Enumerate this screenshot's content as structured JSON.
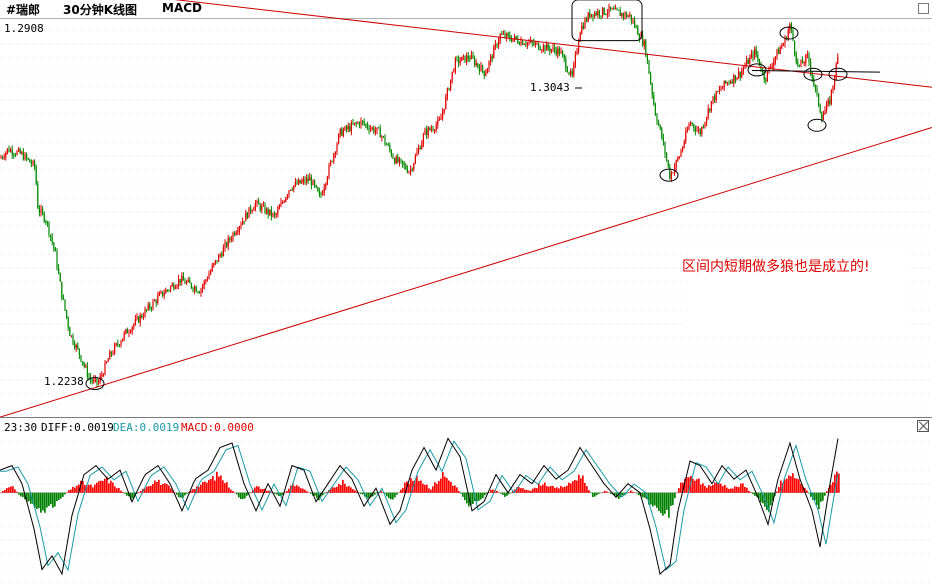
{
  "header": {
    "symbol": "#瑞郎",
    "period": "30分钟K线图",
    "indicator": "MACD"
  },
  "chart_data": [
    {
      "type": "candlestick",
      "title": "#瑞郎 30分钟K线图",
      "y_top_label": "1.2908",
      "ylim": [
        1.218,
        1.2908
      ],
      "grid": true,
      "price_path": [
        {
          "x": 0,
          "y": 1.2653
        },
        {
          "x": 8,
          "y": 1.267
        },
        {
          "x": 22,
          "y": 1.266
        },
        {
          "x": 35,
          "y": 1.2637
        },
        {
          "x": 38,
          "y": 1.256
        },
        {
          "x": 46,
          "y": 1.254
        },
        {
          "x": 55,
          "y": 1.248
        },
        {
          "x": 62,
          "y": 1.24
        },
        {
          "x": 70,
          "y": 1.233
        },
        {
          "x": 80,
          "y": 1.229
        },
        {
          "x": 90,
          "y": 1.2245
        },
        {
          "x": 98,
          "y": 1.2238
        },
        {
          "x": 110,
          "y": 1.229
        },
        {
          "x": 125,
          "y": 1.233
        },
        {
          "x": 140,
          "y": 1.236
        },
        {
          "x": 160,
          "y": 1.24
        },
        {
          "x": 180,
          "y": 1.243
        },
        {
          "x": 200,
          "y": 1.241
        },
        {
          "x": 215,
          "y": 1.246
        },
        {
          "x": 235,
          "y": 1.252
        },
        {
          "x": 255,
          "y": 1.257
        },
        {
          "x": 275,
          "y": 1.2545
        },
        {
          "x": 290,
          "y": 1.26
        },
        {
          "x": 310,
          "y": 1.2615
        },
        {
          "x": 320,
          "y": 1.258
        },
        {
          "x": 340,
          "y": 1.27
        },
        {
          "x": 360,
          "y": 1.272
        },
        {
          "x": 380,
          "y": 1.27
        },
        {
          "x": 395,
          "y": 1.265
        },
        {
          "x": 410,
          "y": 1.263
        },
        {
          "x": 425,
          "y": 1.27
        },
        {
          "x": 440,
          "y": 1.272
        },
        {
          "x": 455,
          "y": 1.283
        },
        {
          "x": 470,
          "y": 1.284
        },
        {
          "x": 485,
          "y": 1.281
        },
        {
          "x": 500,
          "y": 1.288
        },
        {
          "x": 520,
          "y": 1.287
        },
        {
          "x": 540,
          "y": 1.286
        },
        {
          "x": 560,
          "y": 1.285
        },
        {
          "x": 572,
          "y": 1.28
        },
        {
          "x": 580,
          "y": 1.289
        },
        {
          "x": 590,
          "y": 1.292
        },
        {
          "x": 610,
          "y": 1.2925
        },
        {
          "x": 630,
          "y": 1.2915
        },
        {
          "x": 645,
          "y": 1.286
        },
        {
          "x": 655,
          "y": 1.274
        },
        {
          "x": 662,
          "y": 1.269
        },
        {
          "x": 670,
          "y": 1.262
        },
        {
          "x": 680,
          "y": 1.266
        },
        {
          "x": 690,
          "y": 1.272
        },
        {
          "x": 700,
          "y": 1.27
        },
        {
          "x": 712,
          "y": 1.276
        },
        {
          "x": 725,
          "y": 1.279
        },
        {
          "x": 740,
          "y": 1.281
        },
        {
          "x": 755,
          "y": 1.285
        },
        {
          "x": 765,
          "y": 1.28
        },
        {
          "x": 775,
          "y": 1.284
        },
        {
          "x": 785,
          "y": 1.287
        },
        {
          "x": 790,
          "y": 1.29
        },
        {
          "x": 798,
          "y": 1.282
        },
        {
          "x": 808,
          "y": 1.284
        },
        {
          "x": 815,
          "y": 1.278
        },
        {
          "x": 822,
          "y": 1.273
        },
        {
          "x": 830,
          "y": 1.276
        },
        {
          "x": 838,
          "y": 1.284
        }
      ],
      "annotations": [
        {
          "text": "1.3043",
          "type": "label"
        },
        {
          "text": "1.2238",
          "type": "label"
        },
        {
          "text": "区间内短期做多狼也是成立的!",
          "type": "note",
          "color": "#e00000"
        }
      ],
      "trendlines": [
        {
          "name": "upper-resistance",
          "color": "#cc0000",
          "from": [
            0,
            1.2983
          ],
          "to": [
            932,
            1.2784
          ]
        },
        {
          "name": "lower-support",
          "color": "#cc0000",
          "from": [
            0,
            1.2176
          ],
          "to": [
            932,
            1.271
          ]
        },
        {
          "name": "short-resistance",
          "color": "#000000",
          "from": [
            752,
            1.2815
          ],
          "to": [
            880,
            1.2812
          ]
        }
      ],
      "ellipses": [
        {
          "cx": 95,
          "cy": 1.2238
        },
        {
          "cx": 669,
          "cy": 1.2622
        },
        {
          "cx": 757,
          "cy": 1.2816
        },
        {
          "cx": 789,
          "cy": 1.2884
        },
        {
          "cx": 813,
          "cy": 1.2808
        },
        {
          "cx": 838,
          "cy": 1.2808
        },
        {
          "cx": 817,
          "cy": 1.2714
        }
      ],
      "highlight_box": {
        "from_x": 572,
        "to_x": 642
      }
    },
    {
      "type": "bar+line",
      "title": "MACD",
      "time": "23:30",
      "legend": [
        {
          "name": "DIFF",
          "value": "0.0019",
          "color": "#000000"
        },
        {
          "name": "DEA",
          "value": "0.0019",
          "color": "#1a9aa6"
        },
        {
          "name": "MACD",
          "value": "0.0000",
          "color": "#e00000"
        }
      ],
      "bar_colors": {
        "positive": "#ff0000",
        "negative": "#008000"
      },
      "histogram_knots": [
        {
          "x": 0,
          "y": 0.0
        },
        {
          "x": 10,
          "y": 0.4
        },
        {
          "x": 20,
          "y": -0.2
        },
        {
          "x": 32,
          "y": -0.6
        },
        {
          "x": 45,
          "y": -1.0
        },
        {
          "x": 55,
          "y": -0.5
        },
        {
          "x": 68,
          "y": 0.1
        },
        {
          "x": 80,
          "y": 0.5
        },
        {
          "x": 92,
          "y": 0.3
        },
        {
          "x": 105,
          "y": 0.7
        },
        {
          "x": 118,
          "y": 0.2
        },
        {
          "x": 130,
          "y": -0.3
        },
        {
          "x": 142,
          "y": 0.2
        },
        {
          "x": 155,
          "y": 0.6
        },
        {
          "x": 168,
          "y": 0.3
        },
        {
          "x": 180,
          "y": -0.3
        },
        {
          "x": 192,
          "y": 0.2
        },
        {
          "x": 205,
          "y": 0.5
        },
        {
          "x": 218,
          "y": 0.9
        },
        {
          "x": 230,
          "y": 0.2
        },
        {
          "x": 242,
          "y": -0.4
        },
        {
          "x": 255,
          "y": 0.3
        },
        {
          "x": 268,
          "y": 0.1
        },
        {
          "x": 280,
          "y": -0.2
        },
        {
          "x": 292,
          "y": 0.4
        },
        {
          "x": 305,
          "y": 0.1
        },
        {
          "x": 318,
          "y": -0.3
        },
        {
          "x": 330,
          "y": 0.2
        },
        {
          "x": 342,
          "y": 0.5
        },
        {
          "x": 355,
          "y": 0.1
        },
        {
          "x": 368,
          "y": -0.3
        },
        {
          "x": 380,
          "y": 0.1
        },
        {
          "x": 392,
          "y": -0.4
        },
        {
          "x": 405,
          "y": 0.5
        },
        {
          "x": 418,
          "y": 0.7
        },
        {
          "x": 430,
          "y": 0.2
        },
        {
          "x": 442,
          "y": 0.9
        },
        {
          "x": 455,
          "y": 0.3
        },
        {
          "x": 468,
          "y": -0.6
        },
        {
          "x": 480,
          "y": -0.3
        },
        {
          "x": 492,
          "y": 0.2
        },
        {
          "x": 505,
          "y": -0.2
        },
        {
          "x": 518,
          "y": 0.3
        },
        {
          "x": 530,
          "y": 0.1
        },
        {
          "x": 542,
          "y": 0.5
        },
        {
          "x": 555,
          "y": 0.2
        },
        {
          "x": 568,
          "y": 0.4
        },
        {
          "x": 580,
          "y": 0.9
        },
        {
          "x": 592,
          "y": -0.2
        },
        {
          "x": 605,
          "y": 0.1
        },
        {
          "x": 618,
          "y": -0.3
        },
        {
          "x": 630,
          "y": 0.1
        },
        {
          "x": 642,
          "y": -0.2
        },
        {
          "x": 655,
          "y": -0.8
        },
        {
          "x": 668,
          "y": -1.0
        },
        {
          "x": 680,
          "y": 0.5
        },
        {
          "x": 692,
          "y": 0.8
        },
        {
          "x": 705,
          "y": 0.3
        },
        {
          "x": 718,
          "y": 0.5
        },
        {
          "x": 730,
          "y": 0.2
        },
        {
          "x": 742,
          "y": 0.4
        },
        {
          "x": 755,
          "y": -0.2
        },
        {
          "x": 768,
          "y": -0.8
        },
        {
          "x": 780,
          "y": 0.5
        },
        {
          "x": 792,
          "y": 0.9
        },
        {
          "x": 805,
          "y": 0.2
        },
        {
          "x": 818,
          "y": -0.8
        },
        {
          "x": 828,
          "y": 0.3
        },
        {
          "x": 838,
          "y": 1.0
        }
      ],
      "diff_knots": [
        {
          "x": 0,
          "y": 0.5
        },
        {
          "x": 12,
          "y": 0.6
        },
        {
          "x": 22,
          "y": 0.2
        },
        {
          "x": 34,
          "y": -0.8
        },
        {
          "x": 42,
          "y": -1.7
        },
        {
          "x": 52,
          "y": -1.4
        },
        {
          "x": 62,
          "y": -1.8
        },
        {
          "x": 72,
          "y": -0.5
        },
        {
          "x": 84,
          "y": 0.4
        },
        {
          "x": 96,
          "y": 0.6
        },
        {
          "x": 108,
          "y": 0.3
        },
        {
          "x": 120,
          "y": 0.5
        },
        {
          "x": 132,
          "y": -0.2
        },
        {
          "x": 145,
          "y": 0.4
        },
        {
          "x": 158,
          "y": 0.6
        },
        {
          "x": 170,
          "y": 0.2
        },
        {
          "x": 182,
          "y": -0.4
        },
        {
          "x": 195,
          "y": 0.3
        },
        {
          "x": 208,
          "y": 0.5
        },
        {
          "x": 220,
          "y": 1.0
        },
        {
          "x": 232,
          "y": 1.1
        },
        {
          "x": 244,
          "y": 0.2
        },
        {
          "x": 256,
          "y": -0.4
        },
        {
          "x": 268,
          "y": 0.2
        },
        {
          "x": 280,
          "y": -0.3
        },
        {
          "x": 292,
          "y": 0.6
        },
        {
          "x": 304,
          "y": 0.5
        },
        {
          "x": 316,
          "y": -0.2
        },
        {
          "x": 328,
          "y": 0.2
        },
        {
          "x": 340,
          "y": 0.6
        },
        {
          "x": 352,
          "y": 0.3
        },
        {
          "x": 364,
          "y": -0.3
        },
        {
          "x": 376,
          "y": 0.1
        },
        {
          "x": 390,
          "y": -0.7
        },
        {
          "x": 400,
          "y": -0.4
        },
        {
          "x": 412,
          "y": 0.5
        },
        {
          "x": 424,
          "y": 1.0
        },
        {
          "x": 436,
          "y": 0.5
        },
        {
          "x": 448,
          "y": 1.2
        },
        {
          "x": 460,
          "y": 0.8
        },
        {
          "x": 472,
          "y": -0.4
        },
        {
          "x": 484,
          "y": -0.2
        },
        {
          "x": 496,
          "y": 0.4
        },
        {
          "x": 508,
          "y": 0.0
        },
        {
          "x": 520,
          "y": 0.4
        },
        {
          "x": 532,
          "y": 0.2
        },
        {
          "x": 544,
          "y": 0.6
        },
        {
          "x": 556,
          "y": 0.3
        },
        {
          "x": 568,
          "y": 0.5
        },
        {
          "x": 580,
          "y": 1.0
        },
        {
          "x": 592,
          "y": 0.6
        },
        {
          "x": 604,
          "y": 0.2
        },
        {
          "x": 616,
          "y": -0.1
        },
        {
          "x": 628,
          "y": 0.2
        },
        {
          "x": 640,
          "y": 0.0
        },
        {
          "x": 650,
          "y": -0.8
        },
        {
          "x": 660,
          "y": -1.8
        },
        {
          "x": 670,
          "y": -1.6
        },
        {
          "x": 678,
          "y": -0.4
        },
        {
          "x": 690,
          "y": 0.7
        },
        {
          "x": 700,
          "y": 0.6
        },
        {
          "x": 712,
          "y": 0.2
        },
        {
          "x": 722,
          "y": 0.6
        },
        {
          "x": 734,
          "y": 0.3
        },
        {
          "x": 746,
          "y": 0.5
        },
        {
          "x": 758,
          "y": -0.1
        },
        {
          "x": 768,
          "y": -0.7
        },
        {
          "x": 778,
          "y": 0.3
        },
        {
          "x": 790,
          "y": 1.1
        },
        {
          "x": 800,
          "y": 0.3
        },
        {
          "x": 812,
          "y": -0.4
        },
        {
          "x": 820,
          "y": -1.2
        },
        {
          "x": 830,
          "y": 0.2
        },
        {
          "x": 838,
          "y": 1.2
        }
      ],
      "dea_lag": 6,
      "ylim": [
        -2.0,
        1.3
      ]
    }
  ]
}
